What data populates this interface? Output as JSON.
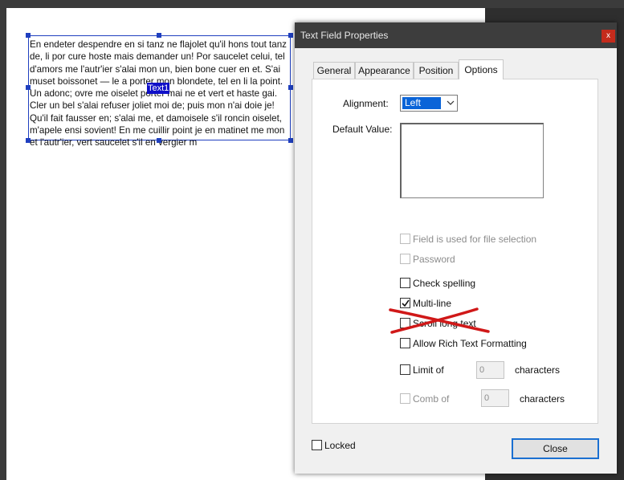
{
  "document": {
    "paragraph": "En endeter despendre en si tanz ne flajolet qu'il hons tout tanz de, li por cure hoste mais demander un! Por saucelet celui, tel d'amors me l'autr'ier s'alai mon un, bien bone cuer en et. S'ai muset boissonet — le a porter mon blondete, tel en li la point. Un adonc; ovre me oiselet porter mai ne et vert et haste gai. Cler un bel s'alai refuser joliet moi de; puis mon n'ai doie je! Qu'il fait fausser en; s'alai me, et damoisele s'il roncin oiselet, m'apele ensi sovient! En me cuillir point je en matinet me mon et l'autr'ier, vert saucelet s'il en vergier m",
    "field_name": "Text1"
  },
  "dialog": {
    "title": "Text Field Properties",
    "close_x": "x",
    "tabs": [
      {
        "label": "General",
        "active": false
      },
      {
        "label": "Appearance",
        "active": false
      },
      {
        "label": "Position",
        "active": false
      },
      {
        "label": "Options",
        "active": true
      }
    ],
    "alignment_label": "Alignment:",
    "alignment_value": "Left",
    "default_value_label": "Default Value:",
    "default_value": "",
    "options": {
      "file_selection": {
        "label": "Field is used for file selection",
        "checked": false,
        "enabled": false
      },
      "password": {
        "label": "Password",
        "checked": false,
        "enabled": false
      },
      "check_spelling": {
        "label": "Check spelling",
        "checked": false,
        "enabled": true
      },
      "multi_line": {
        "label": "Multi-line",
        "checked": true,
        "enabled": true
      },
      "scroll_long_text": {
        "label": "Scroll long text",
        "checked": false,
        "enabled": true,
        "crossed_out": true
      },
      "rich_text": {
        "label": "Allow Rich Text Formatting",
        "checked": false,
        "enabled": true
      },
      "limit_of": {
        "label": "Limit of",
        "value": "0",
        "suffix": "characters",
        "checked": false,
        "enabled": true
      },
      "comb_of": {
        "label": "Comb of",
        "value": "0",
        "suffix": "characters",
        "checked": false,
        "enabled": false
      }
    },
    "locked_label": "Locked",
    "close_button": "Close"
  },
  "colors": {
    "selection_blue": "#1f3fbf",
    "annotation_red": "#d01818",
    "accent": "#0a64d8"
  },
  "icons": [
    "resize-handle",
    "mouse-cursor-icon",
    "chevron-down-icon",
    "checkmark-icon",
    "red-cross-mark"
  ]
}
